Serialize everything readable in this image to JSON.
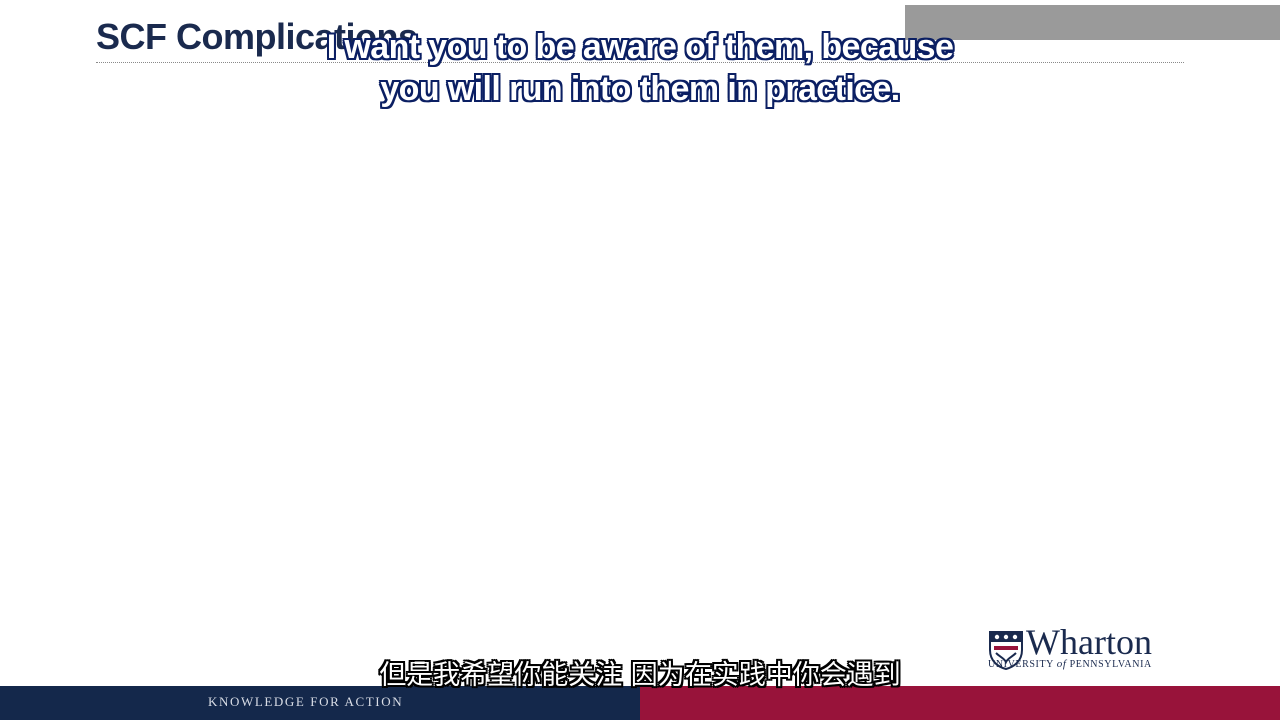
{
  "slide": {
    "title": "SCF Complications"
  },
  "subtitles": {
    "english_line1": "I want you to be aware of them, because",
    "english_line2": "you will run into them in practice.",
    "chinese": "但是我希望你能关注 因为在实践中你会遇到"
  },
  "footer": {
    "tagline": "KNOWLEDGE FOR ACTION",
    "left_color": "#14284b",
    "right_color": "#98133a"
  },
  "logo": {
    "wordmark": "Wharton",
    "university_prefix": "UNIVERSITY",
    "university_of": "of",
    "university_suffix": "PENNSYLVANIA",
    "icon": "penn-shield-icon",
    "color": "#1a2a4e"
  }
}
